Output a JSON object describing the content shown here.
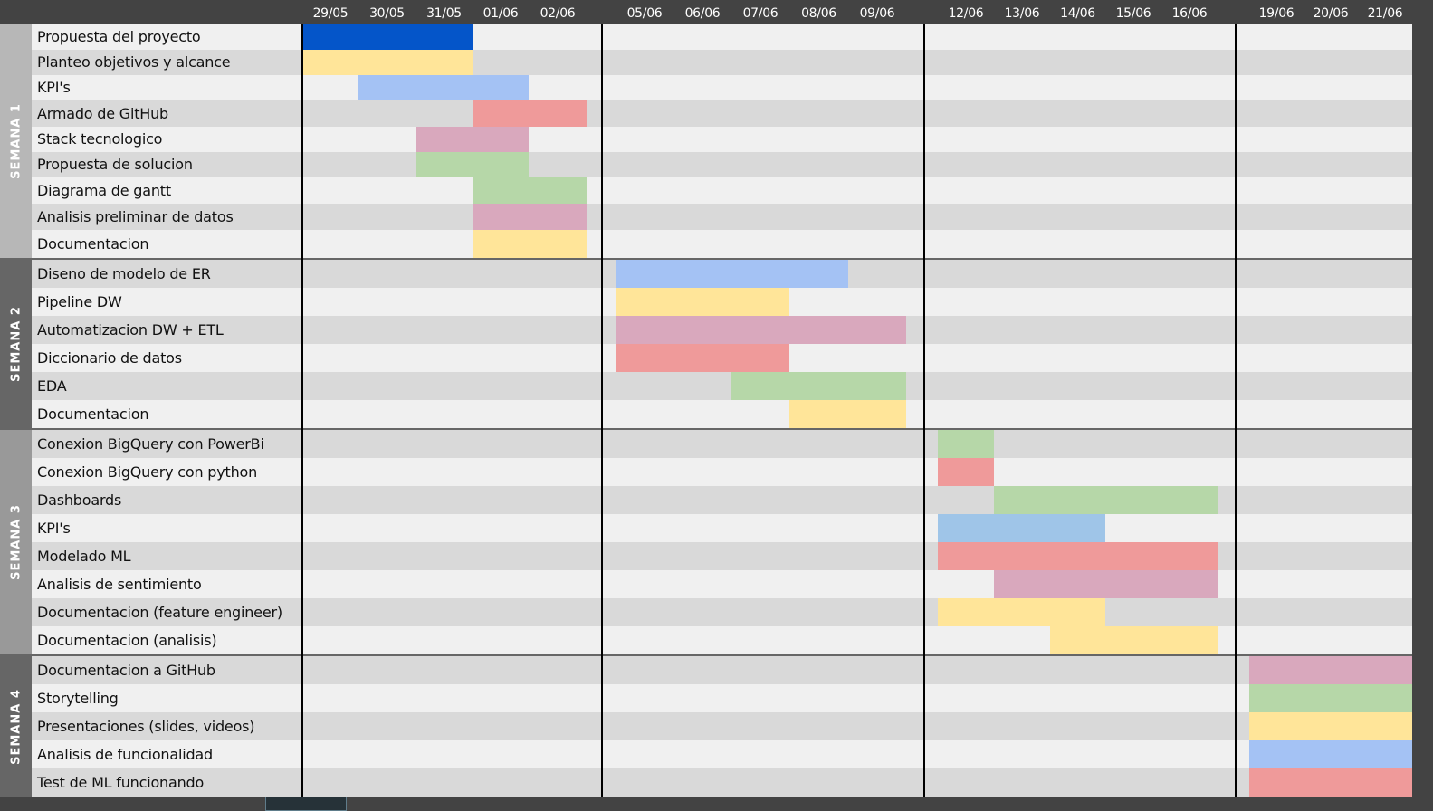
{
  "chart_data": {
    "type": "gantt",
    "dates": [
      "29/05",
      "30/05",
      "31/05",
      "01/06",
      "02/06",
      "05/06",
      "06/06",
      "07/06",
      "08/06",
      "09/06",
      "12/06",
      "13/06",
      "14/06",
      "15/06",
      "16/06",
      "19/06",
      "20/06",
      "21/06"
    ],
    "colors": {
      "dark_blue": "#0455c9",
      "blue": "#a4c2f4",
      "light_blue": "#9fc5e8",
      "yellow": "#ffe599",
      "red": "#ef9a9a",
      "pink": "#d9a8bd",
      "green": "#b6d7a8",
      "row_light": "#f0f0f0",
      "row_dark": "#d9d9d9"
    },
    "groups": [
      {
        "label": "SEMANA 1",
        "color": "#b7b7b7",
        "first_row_dark": false,
        "tasks": [
          {
            "name": "Propuesta del proyecto",
            "start": "29/05",
            "end": "31/05",
            "color": "dark_blue"
          },
          {
            "name": "Planteo objetivos y alcance",
            "start": "29/05",
            "end": "31/05",
            "color": "yellow"
          },
          {
            "name": "KPI's",
            "start": "30/05",
            "end": "01/06",
            "color": "blue"
          },
          {
            "name": "Armado de GitHub",
            "start": "01/06",
            "end": "02/06",
            "color": "red"
          },
          {
            "name": "Stack tecnologico",
            "start": "31/05",
            "end": "01/06",
            "color": "pink"
          },
          {
            "name": "Propuesta de solucion",
            "start": "31/05",
            "end": "01/06",
            "color": "green"
          },
          {
            "name": "Diagrama de gantt",
            "start": "01/06",
            "end": "02/06",
            "color": "green"
          },
          {
            "name": "Analisis preliminar de datos",
            "start": "01/06",
            "end": "02/06",
            "color": "pink"
          },
          {
            "name": "Documentacion",
            "start": "01/06",
            "end": "02/06",
            "color": "yellow"
          }
        ]
      },
      {
        "label": "SEMANA 2",
        "color": "#666666",
        "first_row_dark": true,
        "tasks": [
          {
            "name": "Diseno de modelo de ER",
            "start": "05/06",
            "end": "08/06",
            "color": "blue"
          },
          {
            "name": "Pipeline DW",
            "start": "05/06",
            "end": "07/06",
            "color": "yellow"
          },
          {
            "name": "Automatizacion DW + ETL",
            "start": "05/06",
            "end": "09/06",
            "color": "pink"
          },
          {
            "name": "Diccionario de datos",
            "start": "05/06",
            "end": "07/06",
            "color": "red"
          },
          {
            "name": "EDA",
            "start": "07/06",
            "end": "09/06",
            "color": "green"
          },
          {
            "name": "Documentacion",
            "start": "08/06",
            "end": "09/06",
            "color": "yellow"
          }
        ]
      },
      {
        "label": "SEMANA 3",
        "color": "#999999",
        "first_row_dark": true,
        "tasks": [
          {
            "name": "Conexion BigQuery con PowerBi",
            "start": "12/06",
            "end": "12/06",
            "color": "green"
          },
          {
            "name": "Conexion BigQuery con python",
            "start": "12/06",
            "end": "12/06",
            "color": "red"
          },
          {
            "name": "Dashboards",
            "start": "13/06",
            "end": "16/06",
            "color": "green"
          },
          {
            "name": "KPI's",
            "start": "12/06",
            "end": "14/06",
            "color": "light_blue"
          },
          {
            "name": "Modelado ML",
            "start": "12/06",
            "end": "16/06",
            "color": "red"
          },
          {
            "name": "Analisis de sentimiento",
            "start": "13/06",
            "end": "16/06",
            "color": "pink"
          },
          {
            "name": "Documentacion (feature engineer)",
            "start": "12/06",
            "end": "14/06",
            "color": "yellow"
          },
          {
            "name": "Documentacion (analisis)",
            "start": "14/06",
            "end": "16/06",
            "color": "yellow"
          }
        ]
      },
      {
        "label": "SEMANA 4",
        "color": "#666666",
        "first_row_dark": true,
        "tasks": [
          {
            "name": "Documentacion a GitHub",
            "start": "19/06",
            "end": "21/06",
            "color": "pink"
          },
          {
            "name": "Storytelling",
            "start": "19/06",
            "end": "21/06",
            "color": "green"
          },
          {
            "name": "Presentaciones (slides, videos)",
            "start": "19/06",
            "end": "21/06",
            "color": "yellow"
          },
          {
            "name": "Analisis de funcionalidad",
            "start": "19/06",
            "end": "21/06",
            "color": "blue"
          },
          {
            "name": "Test de ML funcionando",
            "start": "19/06",
            "end": "21/06",
            "color": "red"
          }
        ]
      }
    ]
  }
}
